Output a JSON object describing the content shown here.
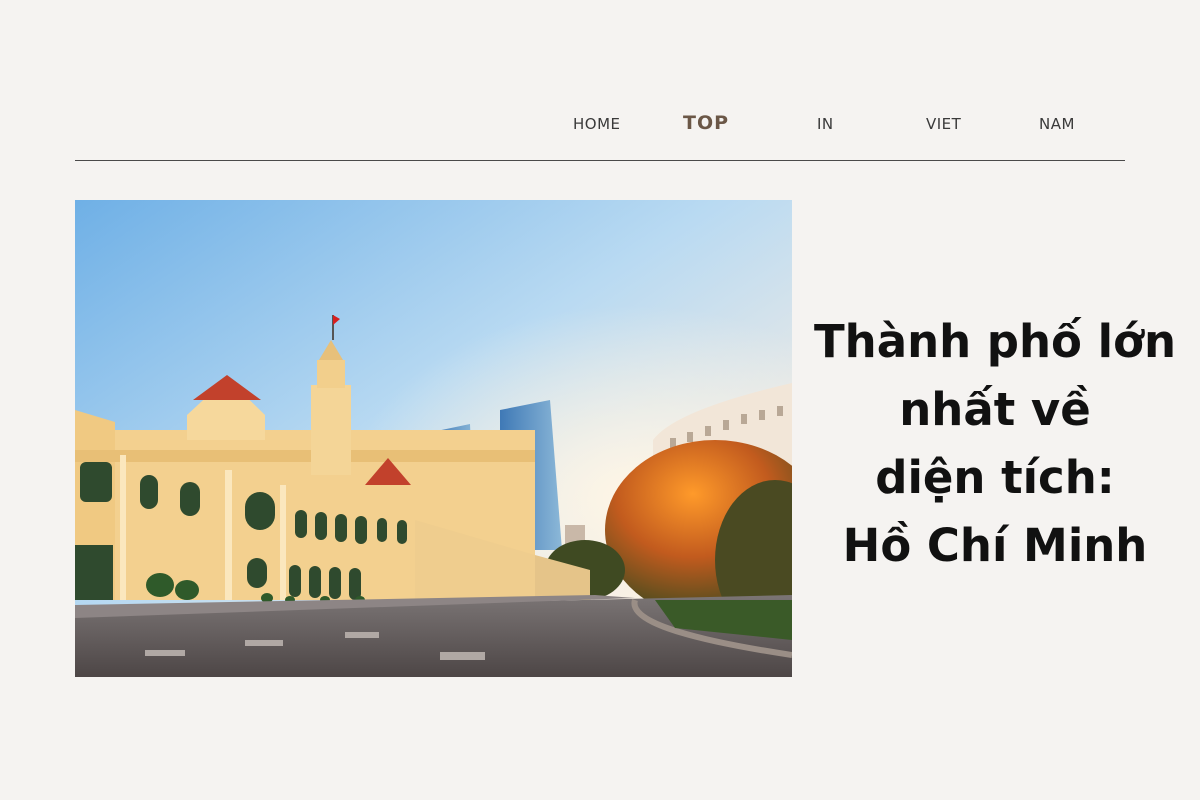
{
  "nav": {
    "items": [
      {
        "label": "HOME"
      },
      {
        "label": "TOP"
      },
      {
        "label": "IN"
      },
      {
        "label": "VIET"
      },
      {
        "label": "NAM"
      }
    ],
    "active_index": 1
  },
  "hero": {
    "headline_lines": [
      "Thành phố lớn",
      "nhất về",
      "diện tích:",
      "Hồ Chí Minh"
    ]
  },
  "colors": {
    "background": "#f5f3f1",
    "nav_text": "#3a3a3a",
    "nav_active": "#6b5747",
    "headline": "#111111"
  }
}
